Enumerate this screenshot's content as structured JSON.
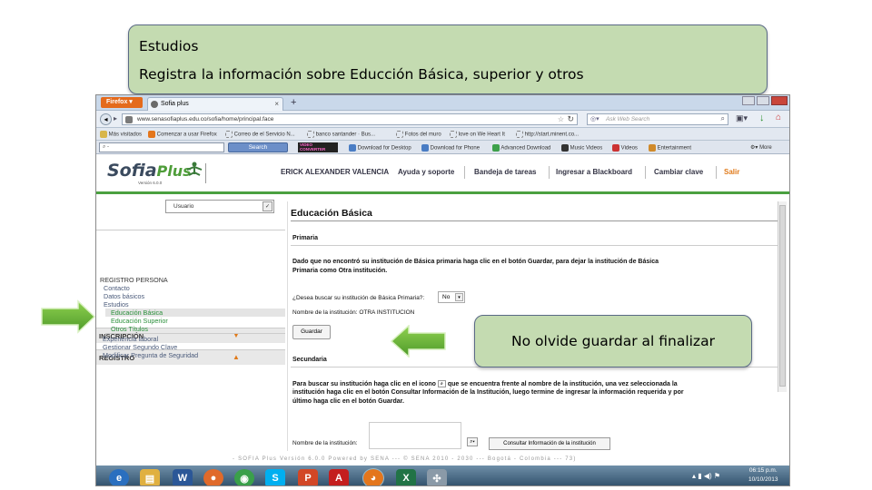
{
  "callout_top": {
    "line1": "Estudios",
    "line2": "Registra la información sobre Educción Básica, superior y otros"
  },
  "callout_save": {
    "text": "No olvide guardar al finalizar"
  },
  "browser": {
    "menu_button": "Firefox",
    "tab_title": "Sofia plus",
    "tab_new": "+",
    "url": "www.senasofiaplus.edu.co/sofia/home/principal.face",
    "search_placeholder": "Ask Web Search",
    "bookmarks": [
      "Más visitados",
      "Comenzar a usar Firefox",
      "Correo de el Servicio N...",
      "banco santander · Bus...",
      "Fotos del muro",
      "love on We Heart It",
      "http://start.minent.co..."
    ],
    "toolbar_search_label": "Search",
    "toolbar_items": [
      "VIDEO CONVERTER",
      "Download for Desktop",
      "Download for Phone",
      "Advanced Download",
      "Music Videos",
      "Videos",
      "Entertainment",
      "More"
    ]
  },
  "header": {
    "logo_main": "Sofia",
    "logo_plus": "Plus",
    "logo_version": "Versión 6.0.0",
    "logo_sena": "SENA",
    "user_name": "ERICK ALEXANDER VALENCIA",
    "nav": [
      "Ayuda y soporte",
      "Bandeja de tareas",
      "Ingresar a Blackboard",
      "Cambiar clave",
      "Salir"
    ]
  },
  "sidebar": {
    "role_select": "Usuario",
    "section_inscripcion": "INSCRIPCIÓN",
    "section_registro": "REGISTRO",
    "group": "REGISTRO PERSONA",
    "items": [
      "Contacto",
      "Datos básicos",
      "Estudios"
    ],
    "subitems": [
      "Educación Básica",
      "Educación Superior",
      "Otros Títulos"
    ],
    "items_after": [
      "Experiencia laboral",
      "Gestionar Segundo Clave",
      "Modificar Pregunta de Seguridad"
    ]
  },
  "content": {
    "title": "Educación Básica",
    "primaria_label": "Primaria",
    "primaria_info_1": "Dado que no encontró su institución de Básica primaria haga clic en el botón Guardar, para dejar la institución de Básica",
    "primaria_info_2": "Primaria como Otra institución.",
    "question": "¿Desea buscar su institución de Básica Primaria?:",
    "question_value": "No",
    "inst_name_label": "Nombre de la institución: OTRA INSTITUCION",
    "save_button": "Guardar",
    "secundaria_label": "Secundaria",
    "secundaria_info_1a": "Para buscar su institución haga clic en el icono",
    "secundaria_info_1b": "que se encuentra frente al nombre de la institución, una vez seleccionada la",
    "secundaria_info_2": "institución haga clic en el botón Consultar Información de la Institución, luego termine de ingresar la información requerida y por",
    "secundaria_info_3": "último haga clic en el botón Guardar.",
    "inst_field_label": "Nombre de la institución:",
    "consult_button": "Consultar Información de la institución"
  },
  "footer": {
    "text": "- SOFIA Plus Versión 6.0.0 Powered by SENA --- © SENA 2010 - 2030 --- Bogotá - Colombia --- 73)"
  },
  "taskbar": {
    "time": "06:15 p.m.",
    "date": "10/10/2013"
  }
}
